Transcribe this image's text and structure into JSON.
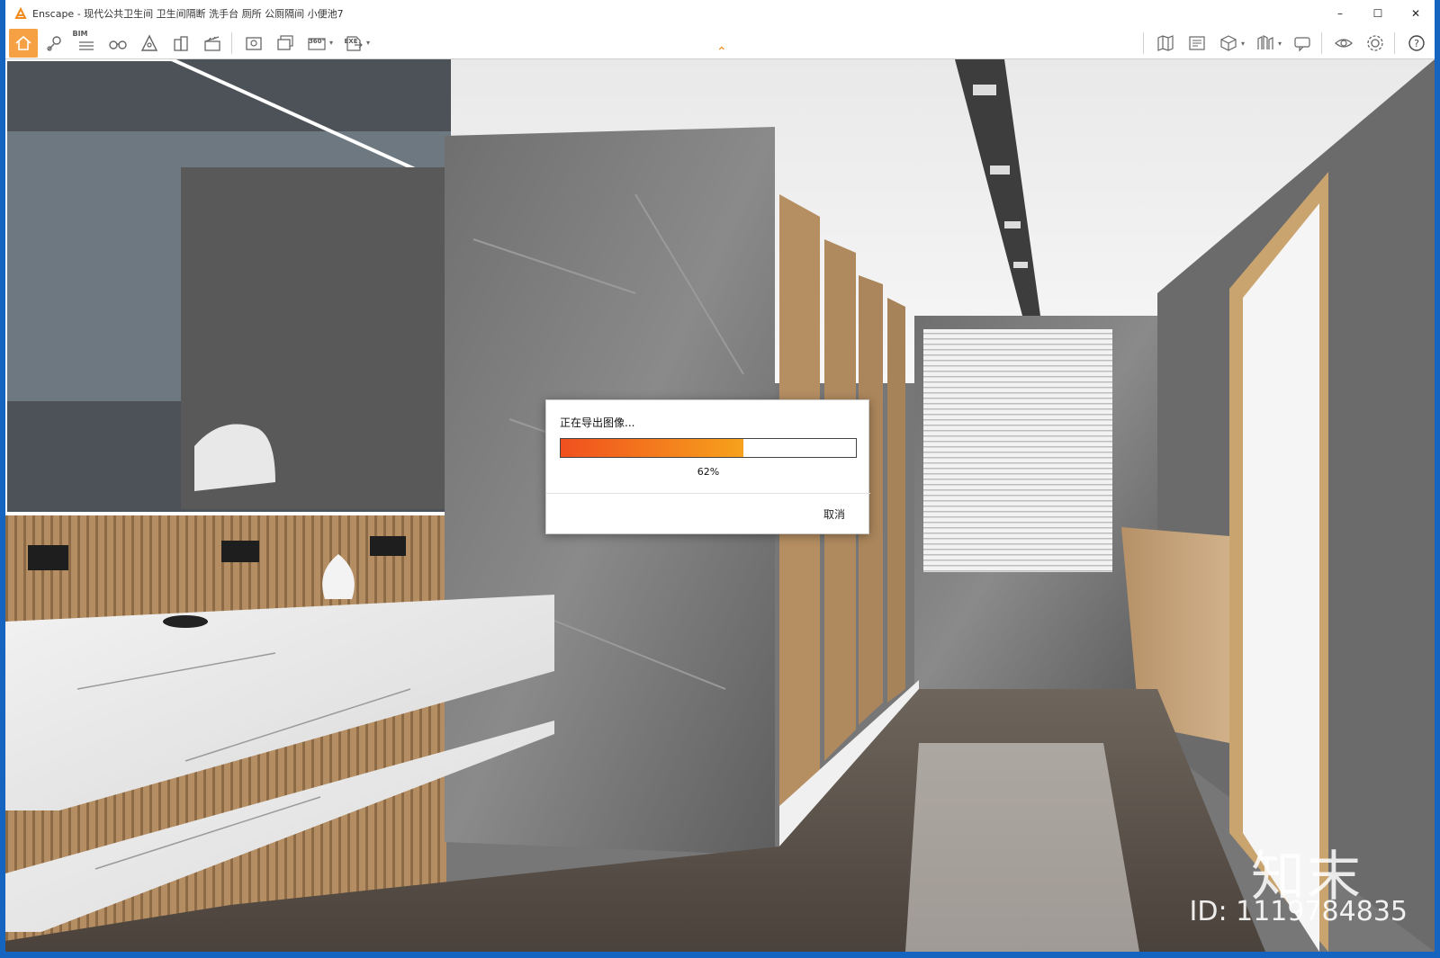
{
  "window": {
    "title": "Enscape - 现代公共卫生间 卫生间隔断 洗手台 厕所 公厕隔间 小便池7",
    "controls": {
      "minimize": "–",
      "maximize": "☐",
      "close": "✕"
    }
  },
  "toolbar": {
    "bim_label": "BIM",
    "pano_label": "360°",
    "exe_label": "EXE",
    "collapse_glyph": "⌃",
    "accent_color": "#f7a145"
  },
  "dialog": {
    "title": "正在导出图像...",
    "progress": 0.62,
    "progress_text": "62%",
    "cancel_label": "取消"
  },
  "watermark": {
    "brand": "知末",
    "id": "ID: 1119784835"
  }
}
